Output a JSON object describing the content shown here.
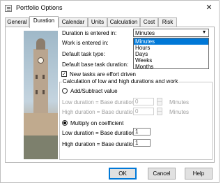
{
  "window": {
    "title": "Portfolio Options",
    "close_glyph": "✕"
  },
  "tabs": [
    {
      "label": "General",
      "active": false
    },
    {
      "label": "Duration",
      "active": true
    },
    {
      "label": "Calendar",
      "active": false
    },
    {
      "label": "Units",
      "active": false
    },
    {
      "label": "Calculation",
      "active": false
    },
    {
      "label": "Cost",
      "active": false
    },
    {
      "label": "Risk",
      "active": false
    }
  ],
  "duration": {
    "duration_label": "Duration is entered in:",
    "duration_value": "Minutes",
    "options": [
      "Minutes",
      "Hours",
      "Days",
      "Weeks",
      "Months"
    ],
    "selected_option": "Minutes",
    "work_label": "Work is entered in:",
    "task_type_label": "Default task type:",
    "base_duration_label": "Default base task duration:",
    "effort_checkbox_label": "New tasks are effort driven",
    "effort_checked": true
  },
  "calculation": {
    "group_title": "Calculation of low and high durations and work",
    "add_subtract_label": "Add/Subtract value",
    "add_subtract_selected": false,
    "low_add_label": "Low duration = Base duration -",
    "low_add_value": "0",
    "low_add_unit": "Minutes",
    "high_add_label": "High duration = Base duration +",
    "high_add_value": "0",
    "high_add_unit": "Minutes",
    "multiply_label": "Multiply on coefficient",
    "multiply_selected": true,
    "low_multiply_label": "Low duration = Base duration *",
    "low_multiply_value": "1",
    "high_multiply_label": "High duration = Base duration *",
    "high_multiply_value": "1"
  },
  "buttons": {
    "ok": "OK",
    "cancel": "Cancel",
    "help": "Help"
  },
  "icons": {
    "app": "window-icon",
    "close": "close-icon",
    "dropdown": "chevron-down-icon",
    "checkbox": "checkbox-checked-icon"
  },
  "colors": {
    "selection": "#0078d7",
    "disabled_text": "#a0a0a0",
    "window_bg": "#ffffff",
    "tab_inactive_bg": "#f0f0f0"
  }
}
